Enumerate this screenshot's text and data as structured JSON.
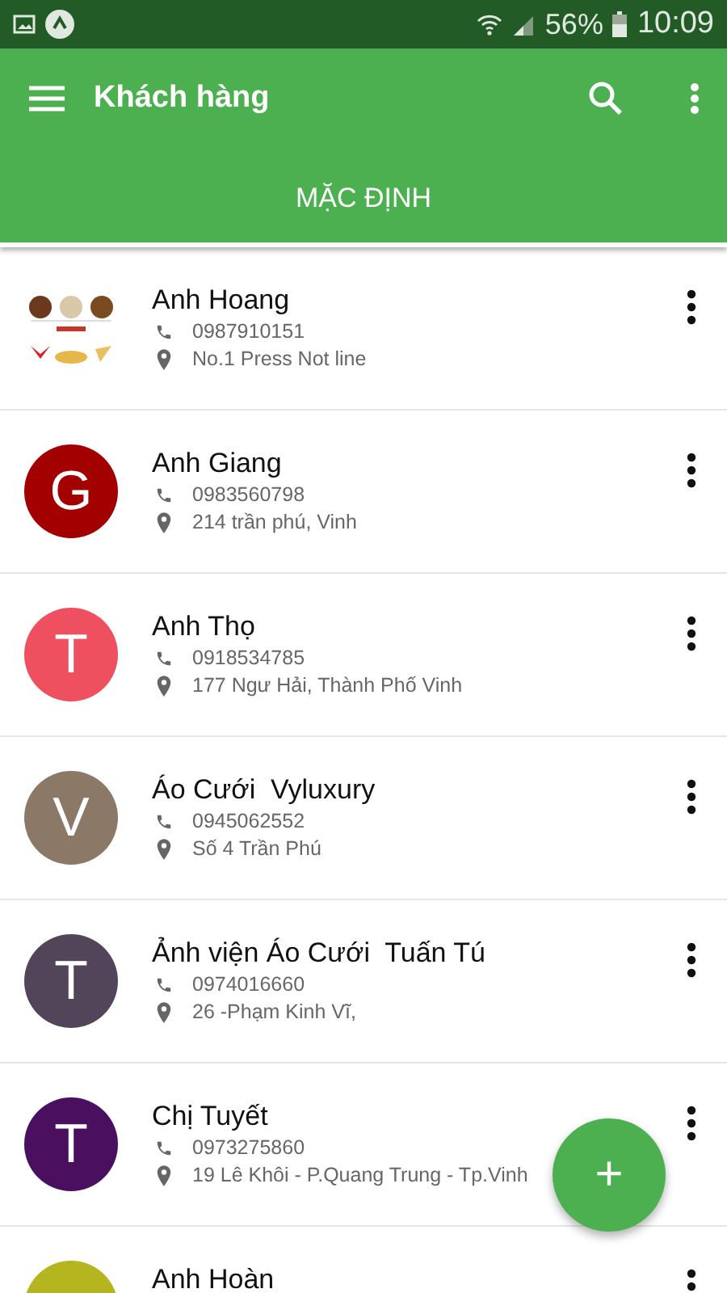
{
  "status_bar": {
    "battery": "56%",
    "time": "10:09"
  },
  "toolbar": {
    "title": "Khách hàng"
  },
  "tabs": [
    {
      "label": "MẶC ĐỊNH",
      "selected": true
    }
  ],
  "customers": [
    {
      "name": "Anh Hoang",
      "phone": "0987910151",
      "address": "No.1 Press Not line"
    },
    {
      "name": "Anh Giang",
      "phone": "0983560798",
      "address": "214 trần phú, Vinh",
      "avatar": {
        "kind": "letter",
        "letter": "G",
        "color": "#a30000"
      }
    },
    {
      "name": "Anh Thọ",
      "phone": "0918534785",
      "address": "177 Ngư Hải, Thành Phố Vinh",
      "avatar": {
        "kind": "letter",
        "letter": "T",
        "color": "#ee5060"
      }
    },
    {
      "name": "Áo Cưới  Vyluxury",
      "phone": "0945062552",
      "address": "Số 4 Trần Phú",
      "avatar": {
        "kind": "letter",
        "letter": "V",
        "color": "#8b7866"
      }
    },
    {
      "name": "Ảnh viện Áo Cưới  Tuấn Tú",
      "phone": "0974016660",
      "address": "26 -Phạm Kinh Vĩ,",
      "avatar": {
        "kind": "letter",
        "letter": "T",
        "color": "#52455a"
      }
    },
    {
      "name": "Chị Tuyết",
      "phone": "0973275860",
      "address": "19 Lê Khôi - P.Quang Trung - Tp.Vinh",
      "avatar": {
        "kind": "letter",
        "letter": "T",
        "color": "#4a0f5e"
      }
    },
    {
      "name": "Anh Hoàn",
      "avatar": {
        "kind": "letter",
        "color": "#b5b520"
      }
    }
  ],
  "fab": {
    "label": "+"
  }
}
